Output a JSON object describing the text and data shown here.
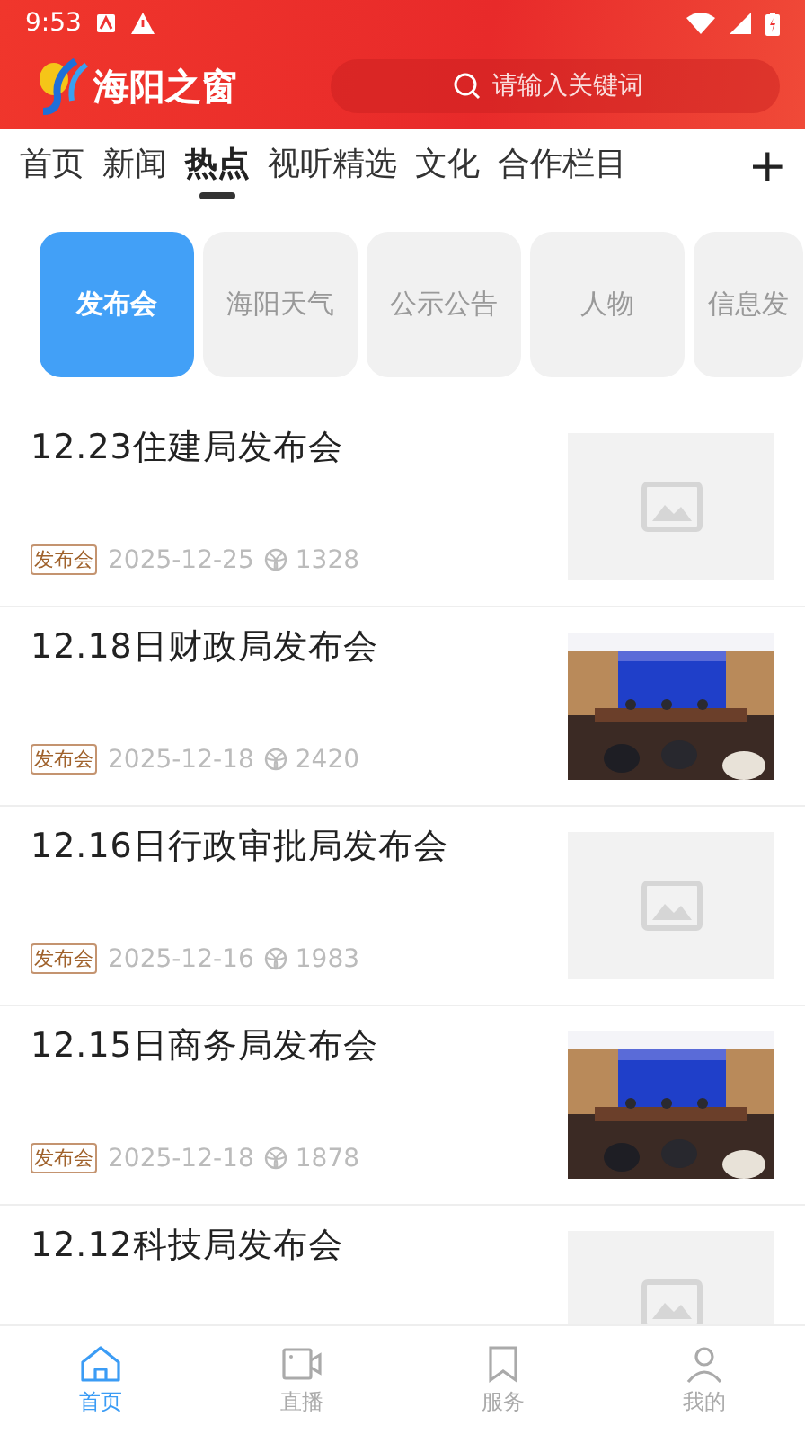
{
  "status_bar": {
    "time": "9:53"
  },
  "header": {
    "app_name": "海阳之窗",
    "search": {
      "placeholder": "请输入关键词"
    }
  },
  "tabs": [
    {
      "label": "首页",
      "selected": false
    },
    {
      "label": "新闻",
      "selected": false
    },
    {
      "label": "热点",
      "selected": true
    },
    {
      "label": "视听精选",
      "selected": false
    },
    {
      "label": "文化",
      "selected": false
    },
    {
      "label": "合作栏目",
      "selected": false
    }
  ],
  "add_button": "+",
  "categories": [
    {
      "label": "发布会",
      "selected": true
    },
    {
      "label": "海阳天气",
      "selected": false
    },
    {
      "label": "公示公告",
      "selected": false
    },
    {
      "label": "人物",
      "selected": false
    },
    {
      "label": "信息发",
      "selected": false
    }
  ],
  "articles": [
    {
      "title": "12.23住建局发布会",
      "tag": "发布会",
      "date": "2025-12-25",
      "views": "1328",
      "image": {
        "kind": "placeholder"
      }
    },
    {
      "title": "12.18日财政局发布会",
      "tag": "发布会",
      "date": "2025-12-18",
      "views": "2420"
    },
    {
      "title": "12.16日行政审批局发布会",
      "tag": "发布会",
      "date": "2025-12-16",
      "views": "1983",
      "image": {
        "kind": "placeholder"
      }
    },
    {
      "title": "12.15日商务局发布会",
      "tag": "发布会",
      "date": "2025-12-18",
      "views": "1878"
    },
    {
      "title": "12.12科技局发布会",
      "image": {
        "kind": "placeholder"
      }
    }
  ],
  "bottom_nav": [
    {
      "label": "首页",
      "kind": "home",
      "selected": true
    },
    {
      "label": "直播",
      "kind": "live",
      "selected": false
    },
    {
      "label": "服务",
      "kind": "service",
      "selected": false
    },
    {
      "label": "我的",
      "kind": "me",
      "selected": false
    }
  ]
}
